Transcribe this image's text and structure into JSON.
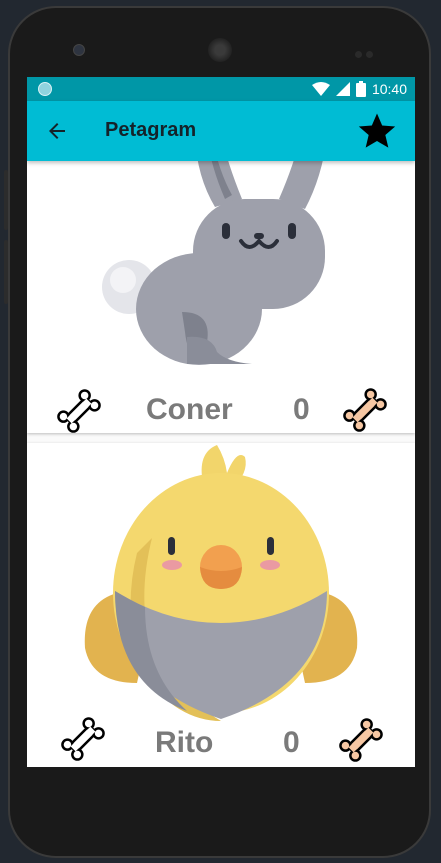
{
  "status_bar": {
    "time": "10:40"
  },
  "app_bar": {
    "title": "Petagram",
    "back_icon": "arrow-back-icon",
    "favorites_icon": "star-icon"
  },
  "pets": [
    {
      "name": "Coner",
      "likes": "0",
      "animal": "rabbit"
    },
    {
      "name": "Rito",
      "likes": "0",
      "animal": "chick"
    }
  ],
  "colors": {
    "primary": "#00bcd4",
    "primary_dark": "#0097a7",
    "text": "#7a7a7a",
    "bone_filled": "#f6c7a3"
  }
}
